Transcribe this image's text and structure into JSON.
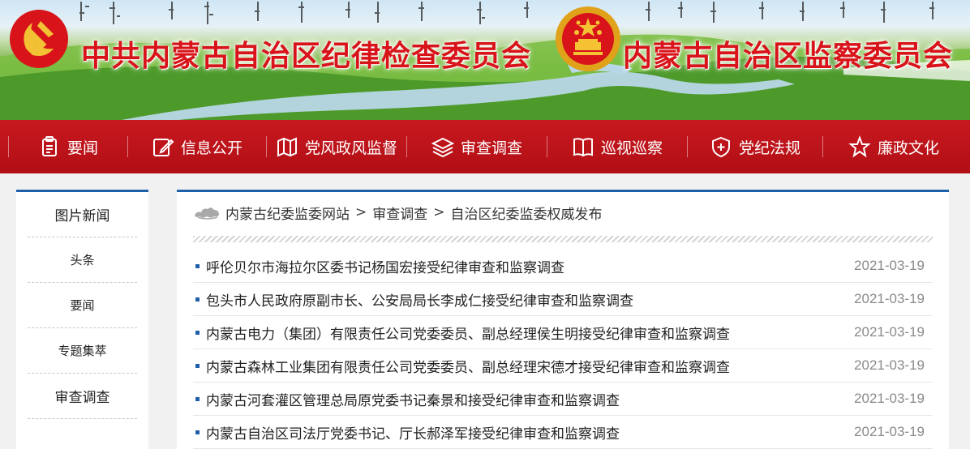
{
  "banner": {
    "title_left": "中共内蒙古自治区纪律检查委员会",
    "title_right": "内蒙古自治区监察委员会",
    "party_emblem_icon": "party-emblem-icon",
    "state_emblem_icon": "national-emblem-icon",
    "colors": {
      "title": "#d8141a"
    }
  },
  "nav": {
    "colors": {
      "background": "#c0141b",
      "text": "#ffffff"
    },
    "items": [
      {
        "label": "要闻",
        "icon": "document-icon"
      },
      {
        "label": "信息公开",
        "icon": "edit-icon"
      },
      {
        "label": "党风政风监督",
        "icon": "map-icon"
      },
      {
        "label": "审查调查",
        "icon": "layers-icon"
      },
      {
        "label": "巡视巡察",
        "icon": "book-icon"
      },
      {
        "label": "党纪法规",
        "icon": "shield-plus-icon"
      },
      {
        "label": "廉政文化",
        "icon": "star-icon"
      }
    ]
  },
  "sidebar": {
    "accent": "#1f5fa8",
    "items": [
      {
        "label": "图片新闻"
      },
      {
        "label": "头条"
      },
      {
        "label": "要闻"
      },
      {
        "label": "专题集萃"
      },
      {
        "label": "审查调查"
      }
    ]
  },
  "breadcrumb": {
    "home_icon": "home-cloud-icon",
    "items": [
      "内蒙古纪委监委网站",
      "审查调查",
      "自治区纪委监委权威发布"
    ],
    "separator": ">"
  },
  "news": {
    "items": [
      {
        "title": "呼伦贝尔市海拉尔区委书记杨国宏接受纪律审查和监察调查",
        "date": "2021-03-19"
      },
      {
        "title": "包头市人民政府原副市长、公安局局长李成仁接受纪律审查和监察调查",
        "date": "2021-03-19"
      },
      {
        "title": "内蒙古电力（集团）有限责任公司党委委员、副总经理侯生明接受纪律审查和监察调查",
        "date": "2021-03-19"
      },
      {
        "title": "内蒙古森林工业集团有限责任公司党委委员、副总经理宋德才接受纪律审查和监察调查",
        "date": "2021-03-19"
      },
      {
        "title": "内蒙古河套灌区管理总局原党委书记秦景和接受纪律审查和监察调查",
        "date": "2021-03-19"
      },
      {
        "title": "内蒙古自治区司法厅党委书记、厅长郝泽军接受纪律审查和监察调查",
        "date": "2021-03-19"
      }
    ]
  }
}
